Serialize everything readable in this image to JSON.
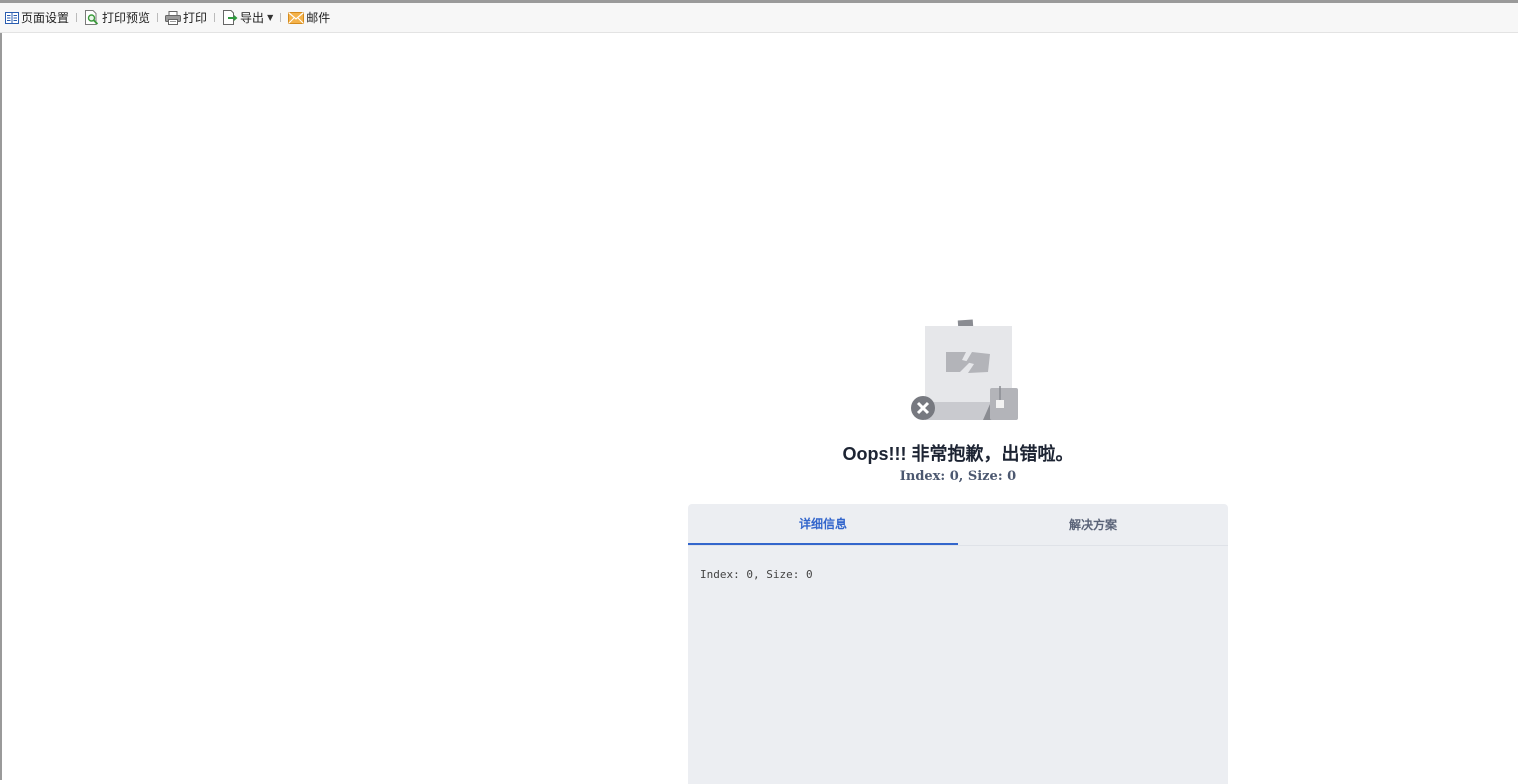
{
  "toolbar": {
    "page_setup": "页面设置",
    "print_preview": "打印预览",
    "print": "打印",
    "export": "导出",
    "mail": "邮件"
  },
  "error": {
    "title": "Oops!!! 非常抱歉，出错啦。",
    "subtitle": "Index: 0, Size: 0",
    "tabs": [
      {
        "label": "详细信息",
        "active": true
      },
      {
        "label": "解决方案",
        "active": false
      }
    ],
    "detail": "Index: 0, Size: 0"
  },
  "colors": {
    "accent": "#3366cc",
    "panel_bg": "#eceef2",
    "title": "#1d2433"
  }
}
